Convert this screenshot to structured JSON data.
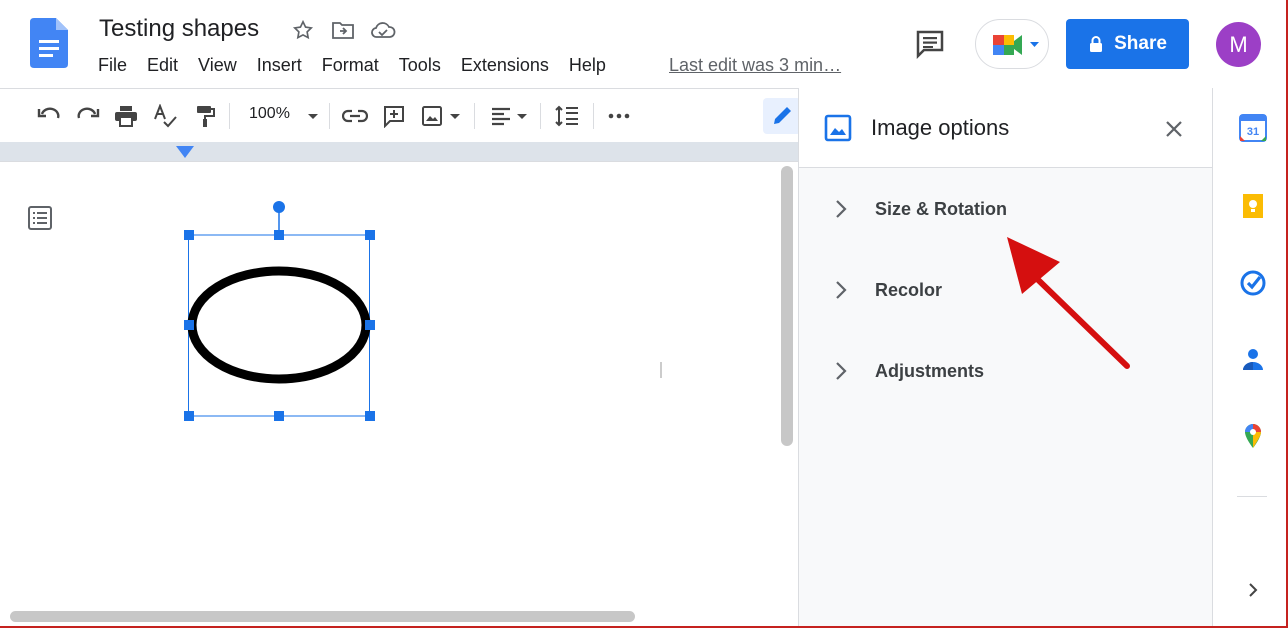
{
  "document": {
    "title": "Testing shapes",
    "last_edit": "Last edit was 3 min…"
  },
  "menu": [
    "File",
    "Edit",
    "View",
    "Insert",
    "Format",
    "Tools",
    "Extensions",
    "Help"
  ],
  "header": {
    "share_label": "Share",
    "avatar_letter": "M"
  },
  "toolbar": {
    "zoom": "100%"
  },
  "panel": {
    "title": "Image options",
    "sections": [
      {
        "label": "Size & Rotation"
      },
      {
        "label": "Recolor"
      },
      {
        "label": "Adjustments"
      }
    ]
  },
  "colors": {
    "accent": "#1a73e8",
    "avatar": "#9c3fc6",
    "annotation_arrow": "#d50f0f"
  },
  "icons": {
    "rail": [
      "calendar-icon",
      "keep-icon",
      "tasks-icon",
      "contacts-icon",
      "maps-icon"
    ]
  },
  "calendar_day": "31"
}
